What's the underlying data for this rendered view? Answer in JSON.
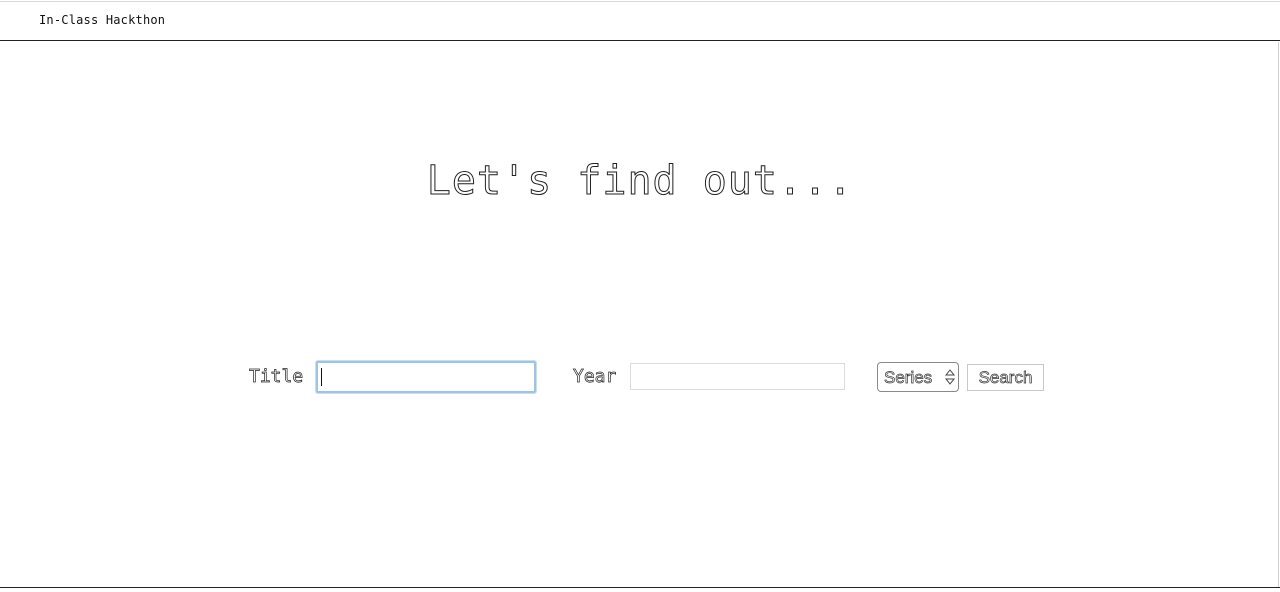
{
  "navbar": {
    "brand": "In-Class Hackthon"
  },
  "hero": {
    "heading": "Let's find out..."
  },
  "search_form": {
    "title_label": "Title",
    "title_value": "",
    "year_label": "Year",
    "year_value": "",
    "type_selected": "Series",
    "search_label": "Search"
  },
  "colors": {
    "focus_ring": "#9ec3ea",
    "text_outline": "#222222",
    "background": "#ffffff"
  }
}
